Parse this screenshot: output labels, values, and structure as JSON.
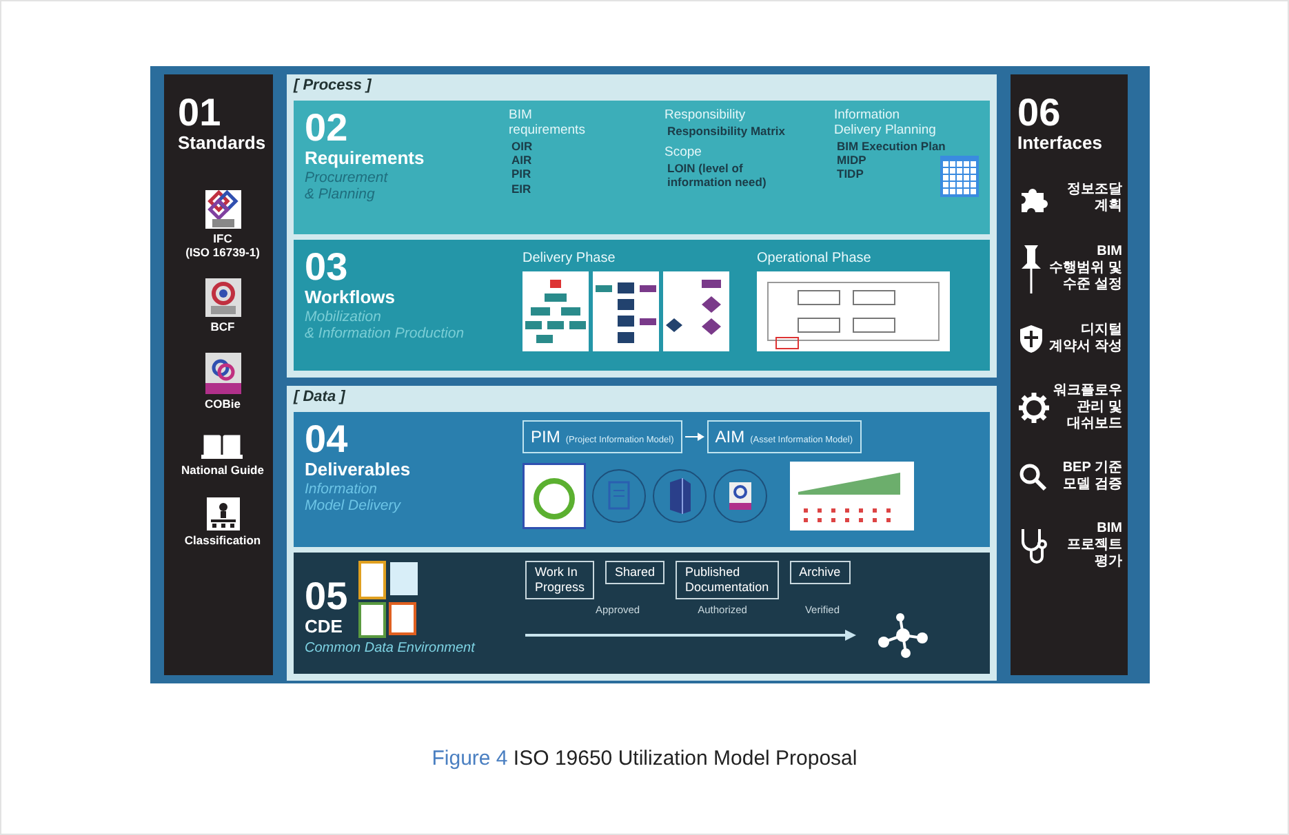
{
  "figure": {
    "standards": {
      "number": "01",
      "title": "Standards",
      "items": [
        {
          "label": "IFC\n(ISO 16739-1)",
          "kind": "ifc"
        },
        {
          "label": "BCF",
          "kind": "bcf"
        },
        {
          "label": "COBie",
          "kind": "cobie"
        },
        {
          "label": "National Guide",
          "kind": "book"
        },
        {
          "label": "Classification",
          "kind": "classification"
        }
      ]
    },
    "process": {
      "label": "[ Process ]",
      "requirements": {
        "number": "02",
        "title": "Requirements",
        "subtitle": "Procurement\n& Planning",
        "columns": [
          {
            "blocks": [
              {
                "heading": "BIM\nrequirements",
                "items": [
                  "OIR",
                  "AIR",
                  "PIR",
                  "EIR"
                ]
              }
            ]
          },
          {
            "blocks": [
              {
                "heading": "Responsibility",
                "items": [
                  "Responsibility Matrix"
                ]
              },
              {
                "heading": "Scope",
                "items": [
                  "LOIN (level of\ninformation need)"
                ]
              }
            ]
          },
          {
            "blocks": [
              {
                "heading": "Information\nDelivery Planning",
                "items": [
                  "BIM Execution Plan",
                  "MIDP",
                  "TIDP"
                ]
              }
            ]
          }
        ]
      },
      "workflows": {
        "number": "03",
        "title": "Workflows",
        "subtitle": "Mobilization\n& Information Production",
        "phases": [
          {
            "title": "Delivery Phase",
            "thumbnails": [
              {
                "kind": "tree"
              },
              {
                "kind": "flow"
              },
              {
                "kind": "decision"
              }
            ]
          },
          {
            "title": "Operational Phase",
            "thumbnails": [
              {
                "kind": "process-map"
              }
            ]
          }
        ]
      }
    },
    "data": {
      "label": "[ Data ]",
      "deliverables": {
        "number": "04",
        "title": "Deliverables",
        "subtitle": "Information\nModel Delivery",
        "models": [
          {
            "abbr": "PIM",
            "name": "(Project Information Model)"
          },
          {
            "abbr": "AIM",
            "name": "(Asset Information Model)"
          }
        ]
      },
      "cde": {
        "number": "05",
        "title": "CDE",
        "subtitle": "Common Data Environment",
        "states": [
          "Work In\nProgress",
          "Shared",
          "Published\nDocumentation",
          "Archive"
        ],
        "transitions": [
          "Approved",
          "Authorized",
          "Verified"
        ]
      }
    },
    "interfaces": {
      "number": "06",
      "title": "Interfaces",
      "items": [
        {
          "label": "정보조달\n계획",
          "kind": "puzzle"
        },
        {
          "label": "BIM\n수행범위 및\n수준 설정",
          "kind": "pin"
        },
        {
          "label": "디지털\n계약서 작성",
          "kind": "shield"
        },
        {
          "label": "워크플로우\n관리 및\n대쉬보드",
          "kind": "gear"
        },
        {
          "label": "BEP 기준\n모델 검증",
          "kind": "search"
        },
        {
          "label": "BIM\n프로젝트\n평가",
          "kind": "stethoscope"
        }
      ]
    }
  },
  "caption": {
    "label": "Figure 4",
    "text": "ISO 19650 Utilization Model Proposal"
  }
}
